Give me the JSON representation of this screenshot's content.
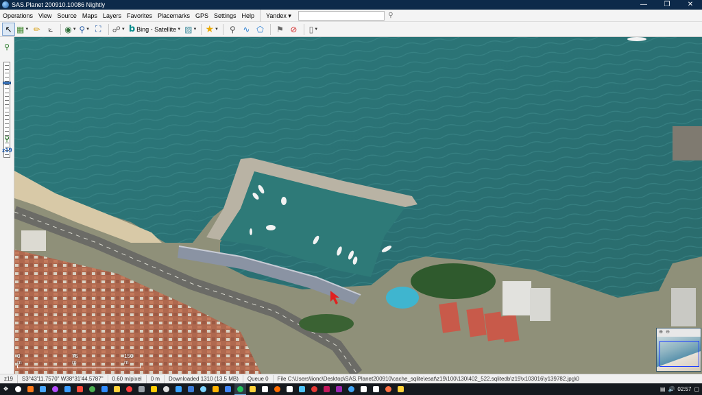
{
  "window": {
    "title": "SAS.Planet 200910.10086 Nightly",
    "minimize": "—",
    "maximize": "❐",
    "close": "✕"
  },
  "menu": {
    "items": [
      "Operations",
      "View",
      "Source",
      "Maps",
      "Layers",
      "Favorites",
      "Placemarks",
      "GPS",
      "Settings",
      "Help"
    ],
    "search_provider": "Yandex ▾",
    "search_value": "",
    "search_icon": "magnifier-icon"
  },
  "toolbar": {
    "map_source_label": "Bing - Satellite",
    "dropdown_arrow": "▾"
  },
  "zoom": {
    "level_label": "z19",
    "level": 19,
    "max_level": 24
  },
  "map": {
    "scale_left": "0 m",
    "scale_mid": "75 m",
    "scale_right": "150 m"
  },
  "status": {
    "zoom": "z19",
    "coords": "S3°43'11.7570\" W38°31'44.5787\"",
    "resolution": "0.60 m/pixel",
    "distance": "0 m",
    "downloaded": "Downloaded 1310 (13.5 MB)",
    "queue": "Queue 0",
    "file": "File C:\\Users\\lionc\\Desktop\\SAS.Planet200910\\cache_sqlite\\esat\\z19\\100\\130\\402_522.sqlitedb\\z19\\x103016\\y139782.jpg\\0"
  },
  "taskbar": {
    "clock": "02:57",
    "app_colors": [
      "#ffffff",
      "#ff7a1a",
      "#4aa8ff",
      "#b44cff",
      "#3b9dff",
      "#ff4a3a",
      "#4caf50",
      "#2f8bff",
      "#ffd23a",
      "#ff3b3b",
      "#9aa0a6",
      "#ffcc00",
      "#e0e0e0",
      "#3aa3ff",
      "#3d7bd6",
      "#7dd3ff",
      "#ffb300",
      "#4285f4",
      "#21c15b",
      "#ffd23a",
      "#ffffff",
      "#ff6d00",
      "#ffffff",
      "#4fc3f7",
      "#e53935",
      "#c2185b",
      "#9c27b0",
      "#42a5f5",
      "#ffffff",
      "#ffffff",
      "#ff7043",
      "#ffd23a"
    ]
  }
}
